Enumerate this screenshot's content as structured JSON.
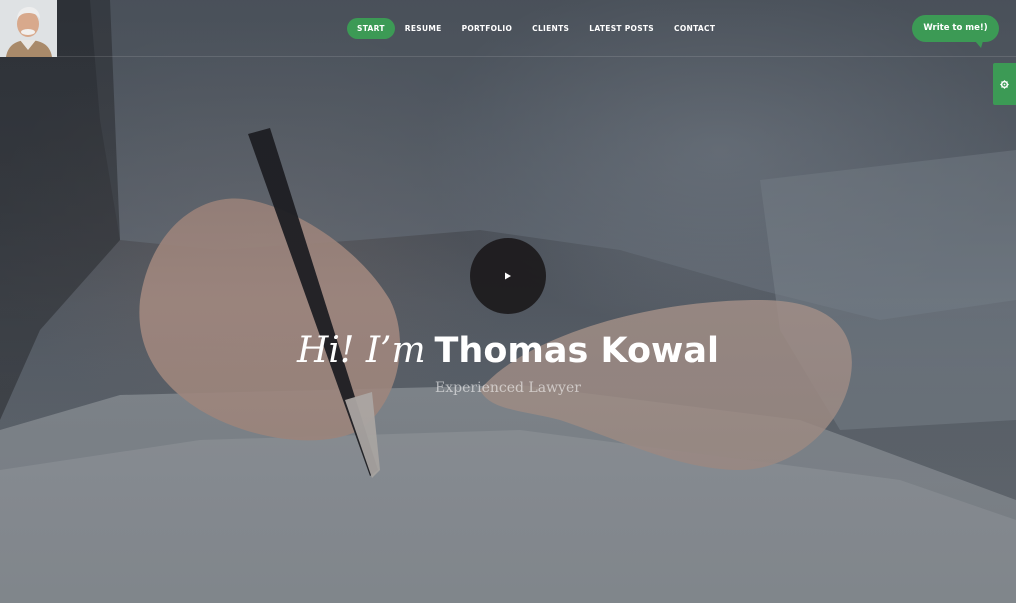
{
  "header": {
    "nav": [
      {
        "label": "START",
        "active": true
      },
      {
        "label": "RESUME",
        "active": false
      },
      {
        "label": "PORTFOLIO",
        "active": false
      },
      {
        "label": "CLIENTS",
        "active": false
      },
      {
        "label": "LATEST POSTS",
        "active": false
      },
      {
        "label": "CONTACT",
        "active": false
      }
    ],
    "cta_label": "Write to me!)"
  },
  "hero": {
    "greeting": "Hi! I’m",
    "name": "Thomas Kowal",
    "subtitle": "Experienced Lawyer"
  },
  "icons": {
    "play": "play-icon",
    "settings": "gear-icon"
  },
  "colors": {
    "accent": "#3c9a55",
    "play_bg": "#1c1a1c",
    "text": "#ffffff"
  }
}
